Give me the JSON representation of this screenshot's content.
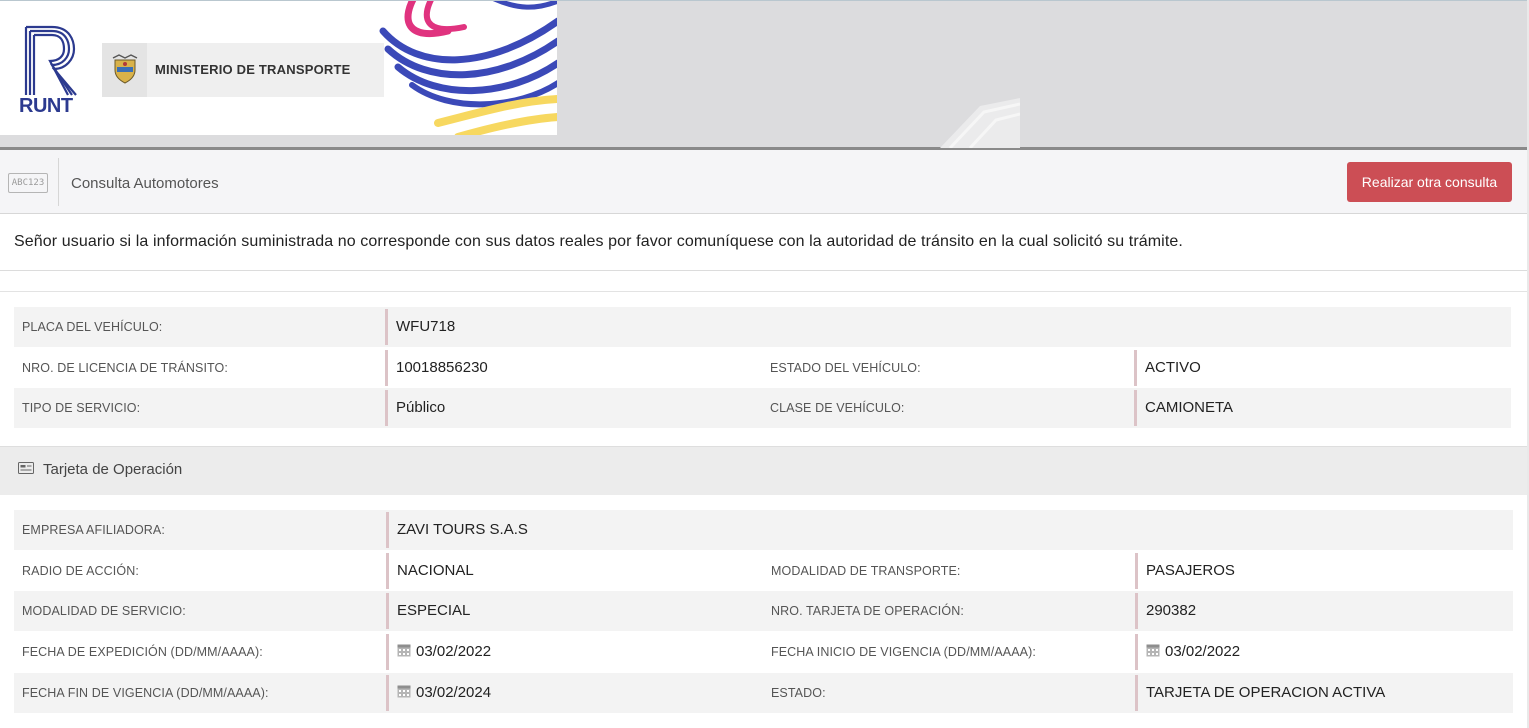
{
  "header": {
    "logo_text": "RUNT",
    "ministry_label": "MINISTERIO DE TRANSPORTE"
  },
  "subbar": {
    "icon": "abc123-plate-icon",
    "icon_text": "ABC123",
    "title": "Consulta Automotores",
    "button_label": "Realizar otra consulta"
  },
  "notice": "Señor usuario si la información suministrada no corresponde con sus datos reales por favor comuníquese con la autoridad de tránsito en la cual solicitó su trámite.",
  "vehicle": {
    "placa_label": "PLACA DEL VEHÍCULO:",
    "placa_value": "WFU718",
    "licencia_label": "NRO. DE LICENCIA DE TRÁNSITO:",
    "licencia_value": "10018856230",
    "estado_label": "ESTADO DEL VEHÍCULO:",
    "estado_value": "ACTIVO",
    "servicio_label": "TIPO DE SERVICIO:",
    "servicio_value": "Público",
    "clase_label": "CLASE DE VEHÍCULO:",
    "clase_value": "CAMIONETA"
  },
  "tarjeta": {
    "section_title": "Tarjeta de Operación",
    "empresa_label": "EMPRESA AFILIADORA:",
    "empresa_value": "ZAVI TOURS S.A.S",
    "radio_label": "RADIO DE ACCIÓN:",
    "radio_value": "NACIONAL",
    "modalidad_transporte_label": "MODALIDAD DE TRANSPORTE:",
    "modalidad_transporte_value": "PASAJEROS",
    "modalidad_servicio_label": "MODALIDAD DE SERVICIO:",
    "modalidad_servicio_value": "ESPECIAL",
    "nro_tarjeta_label": "NRO. TARJETA DE OPERACIÓN:",
    "nro_tarjeta_value": "290382",
    "fecha_expedicion_label": "FECHA DE EXPEDICIÓN (DD/MM/AAAA):",
    "fecha_expedicion_value": "03/02/2022",
    "fecha_inicio_label": "FECHA INICIO DE VIGENCIA (DD/MM/AAAA):",
    "fecha_inicio_value": "03/02/2022",
    "fecha_fin_label": "FECHA FIN DE VIGENCIA (DD/MM/AAAA):",
    "fecha_fin_value": "03/02/2024",
    "estado_label": "ESTADO:",
    "estado_value": "TARJETA DE OPERACION ACTIVA"
  },
  "colors": {
    "accent_button": "#cc4e55",
    "value_bar": "#dcc3c7",
    "runt_blue": "#2c3a8f",
    "ribbon_pink": "#e0337f",
    "ribbon_yellow": "#f7d860"
  }
}
